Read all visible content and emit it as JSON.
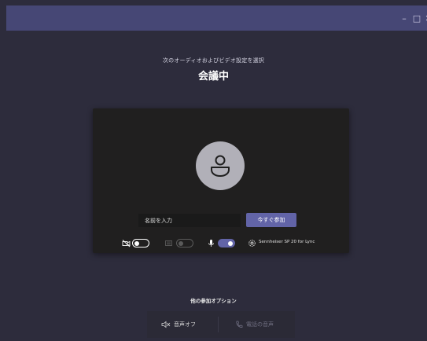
{
  "window": {
    "minimize_glyph": "–",
    "maximize_glyph": "□",
    "close_glyph": "✕"
  },
  "header": {
    "subtitle": "次のオーディオおよびビデオ設定を選択",
    "title": "会議中"
  },
  "preview": {
    "name_placeholder": "名前を入力",
    "join_label": "今すぐ参加",
    "device_name": "Sennheiser SP 20 for Lync"
  },
  "toggles": {
    "camera": "off",
    "blur": "disabled",
    "microphone": "on"
  },
  "colors": {
    "background": "#2d2c3c",
    "titlebar": "#464775",
    "accent": "#6264a7",
    "panel": "#201f1f"
  },
  "other_options": {
    "title": "他の参加オプション",
    "audio_off_label": "音声オフ",
    "phone_audio_label": "電話の音声"
  }
}
